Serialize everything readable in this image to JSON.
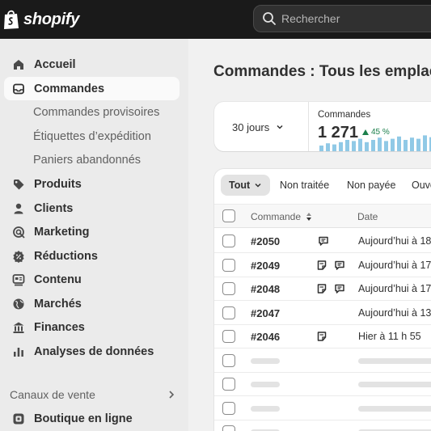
{
  "brand": {
    "name": "shopify"
  },
  "search": {
    "placeholder": "Rechercher"
  },
  "sidebar": {
    "items": [
      {
        "label": "Accueil",
        "icon": "home-icon"
      },
      {
        "label": "Commandes",
        "icon": "inbox-icon",
        "active": true
      },
      {
        "label": "Commandes provisoires"
      },
      {
        "label": "Étiquettes d’expédition"
      },
      {
        "label": "Paniers abandonnés"
      },
      {
        "label": "Produits",
        "icon": "tag-icon"
      },
      {
        "label": "Clients",
        "icon": "person-icon"
      },
      {
        "label": "Marketing",
        "icon": "target-icon"
      },
      {
        "label": "Réductions",
        "icon": "discount-icon"
      },
      {
        "label": "Contenu",
        "icon": "content-icon"
      },
      {
        "label": "Marchés",
        "icon": "globe-icon"
      },
      {
        "label": "Finances",
        "icon": "bank-icon"
      },
      {
        "label": "Analyses de données",
        "icon": "chart-icon"
      }
    ],
    "sales_channels_label": "Canaux de vente",
    "online_store_label": "Boutique en ligne"
  },
  "main": {
    "title": "Commandes :  Tous les emplac",
    "period": "30 jours",
    "metric": {
      "label": "Commandes",
      "value": "1 271",
      "delta": "45 %"
    },
    "tabs": [
      "Tout",
      "Non traitée",
      "Non payée",
      "Ouve"
    ],
    "columns": {
      "order": "Commande",
      "date": "Date"
    },
    "rows": [
      {
        "number": "#2050",
        "date": "Aujourd’hui à 18"
      },
      {
        "number": "#2049",
        "date": "Aujourd’hui à 17"
      },
      {
        "number": "#2048",
        "date": "Aujourd’hui à 17"
      },
      {
        "number": "#2047",
        "date": "Aujourd’hui à 13"
      },
      {
        "number": "#2046",
        "date": "Hier à 11 h 55"
      }
    ]
  },
  "colors": {
    "topbar": "#1a1a1a",
    "accent_green": "#1b7f4b",
    "spark_blue": "#7cc0e2"
  }
}
